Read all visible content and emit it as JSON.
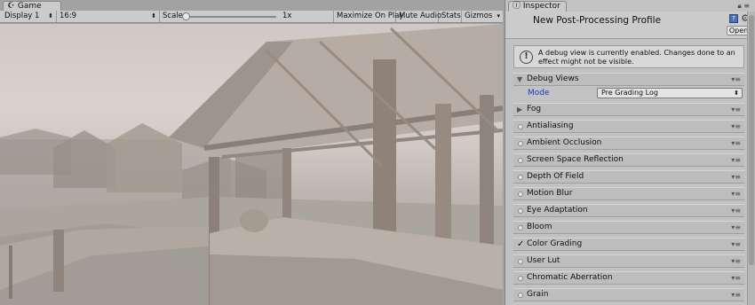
{
  "game": {
    "tab_label": "Game",
    "display": "Display 1",
    "aspect": "16:9",
    "scale_label": "Scale",
    "scale_value": "1x",
    "maximize_on_play": "Maximize On Play",
    "mute_audio": "Mute Audio",
    "stats": "Stats",
    "gizmos": "Gizmos"
  },
  "inspector": {
    "tab_label": "Inspector",
    "title": "New Post-Processing Profile",
    "open_button": "Open",
    "help_message": "A debug view is currently enabled. Changes done to an effect might not be visible.",
    "debug_views_label": "Debug Views",
    "mode_label": "Mode",
    "mode_value": "Pre Grading Log",
    "fog_label": "Fog",
    "effects": [
      {
        "label": "Antialiasing",
        "enabled": false
      },
      {
        "label": "Ambient Occlusion",
        "enabled": false
      },
      {
        "label": "Screen Space Reflection",
        "enabled": false
      },
      {
        "label": "Depth Of Field",
        "enabled": false
      },
      {
        "label": "Motion Blur",
        "enabled": false
      },
      {
        "label": "Eye Adaptation",
        "enabled": false
      },
      {
        "label": "Bloom",
        "enabled": false
      },
      {
        "label": "Color Grading",
        "enabled": true
      },
      {
        "label": "User Lut",
        "enabled": false
      },
      {
        "label": "Chromatic Aberration",
        "enabled": false
      },
      {
        "label": "Grain",
        "enabled": false
      }
    ]
  },
  "colors": {
    "panel_bg": "#c2c2c2",
    "header_bg": "#cbcbcb",
    "mode_label": "#1a3bbd"
  }
}
